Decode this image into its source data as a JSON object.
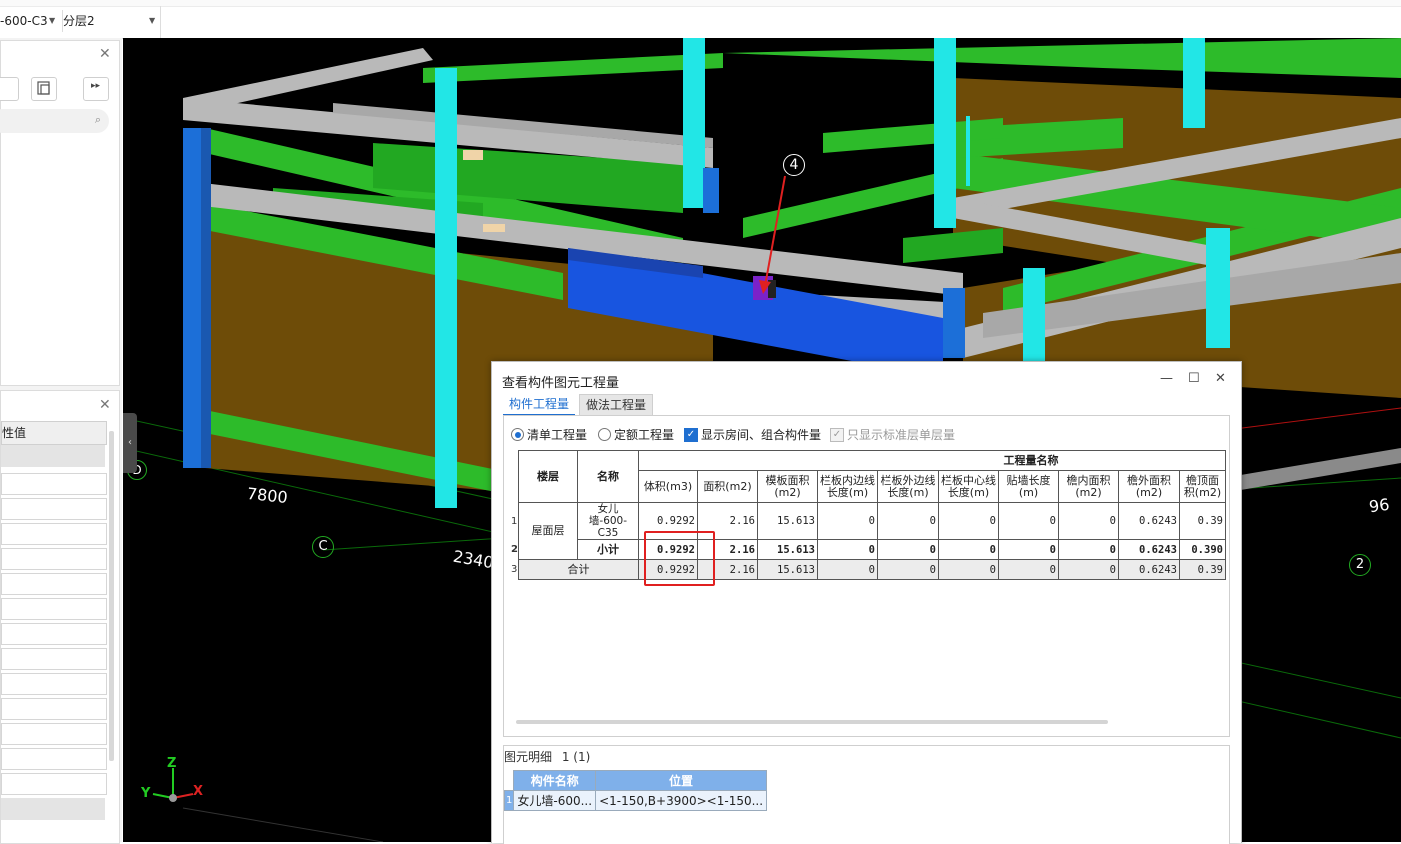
{
  "toolbar": {
    "component_select": "-600-C3",
    "layer_select": "分层2"
  },
  "left_panel": {
    "prop_header_value": "性值"
  },
  "viewport": {
    "grid_labels": {
      "number_4": "4",
      "letter_c": "C",
      "letter_d": "D",
      "number_2": "2",
      "dim_7800": "7800",
      "dim_2340": "2340",
      "dim_96": "96"
    },
    "axis": {
      "x": "X",
      "y": "Y",
      "z": "Z"
    }
  },
  "dialog": {
    "title": "查看构件图元工程量",
    "tabs": [
      {
        "label": "构件工程量",
        "active": true
      },
      {
        "label": "做法工程量",
        "active": false
      }
    ],
    "options": {
      "radio_bill": "清单工程量",
      "radio_quota": "定额工程量",
      "check_room": "显示房间、组合构件量",
      "check_std": "只显示标准层单层量"
    },
    "table": {
      "group_header": "工程量名称",
      "col_floor": "楼层",
      "col_name": "名称",
      "qty_headers": [
        "体积(m3)",
        "面积(m2)",
        "模板面积(m2)",
        "栏板内边线长度(m)",
        "栏板外边线长度(m)",
        "栏板中心线长度(m)",
        "贴墙长度(m)",
        "檐内面积(m2)",
        "檐外面积(m2)",
        "檐顶面积(m2)"
      ],
      "row_numbers": [
        "1",
        "2",
        "3"
      ],
      "floor": "屋面层",
      "item_name": "女儿墙-600-C35",
      "subtotal_label": "小计",
      "total_label": "合计",
      "values": [
        "0.9292",
        "2.16",
        "15.613",
        "0",
        "0",
        "0",
        "0",
        "0",
        "0.6243",
        "0.39"
      ],
      "subtotal_values": [
        "0.9292",
        "2.16",
        "15.613",
        "0",
        "0",
        "0",
        "0",
        "0",
        "0.6243",
        "0.390"
      ],
      "total_values": [
        "0.9292",
        "2.16",
        "15.613",
        "0",
        "0",
        "0",
        "0",
        "0",
        "0.6243",
        "0.39"
      ]
    },
    "detail": {
      "label": "图元明细",
      "count": "1 (1)",
      "col_name": "构件名称",
      "col_pos": "位置",
      "row_num": "1",
      "row_name": "女儿墙-600...",
      "row_pos": "<1-150,B+3900><1-150..."
    }
  },
  "colors": {
    "beam_green": "#2dbb2a",
    "column_cyan": "#22e6e6",
    "wall_brown": "#6e4c08",
    "beam_gray": "#b9b9b9",
    "highlight_blue": "#1855e0",
    "accent": "#1f6fd0",
    "red_box": "#e02020"
  }
}
